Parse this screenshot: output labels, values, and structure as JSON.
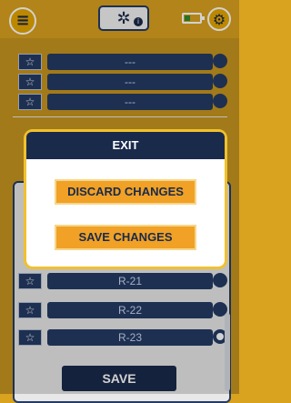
{
  "topbar": {
    "menu_icon": "menu-icon",
    "center_icon": "gear-device-icon",
    "info_badge": "i",
    "battery_icon": "battery-icon",
    "settings_icon": "settings-icon"
  },
  "list_top": {
    "rows": [
      {
        "label": "---"
      },
      {
        "label": "---"
      },
      {
        "label": "---"
      }
    ]
  },
  "list_bottom": {
    "rows": [
      {
        "label": "R-21"
      },
      {
        "label": "R-22"
      },
      {
        "label": "R-23"
      }
    ]
  },
  "footer": {
    "save_label": "SAVE"
  },
  "modal": {
    "title": "EXIT",
    "discard_label": "DISCARD CHANGES",
    "save_label": "SAVE CHANGES"
  },
  "colors": {
    "accent": "#d9a21f",
    "navy": "#1a2a4b",
    "button_orange": "#f0a126",
    "modal_border": "#f0c12e"
  }
}
